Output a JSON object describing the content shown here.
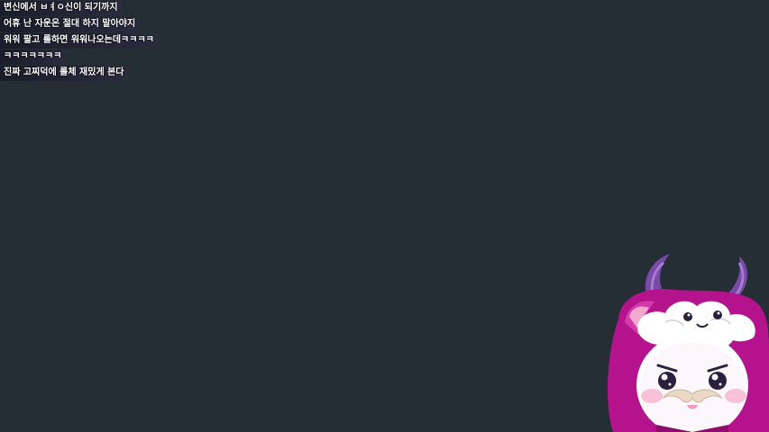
{
  "chat": {
    "messages": [
      {
        "text": "변신에서 ㅂㅕㅇ신이 되기까지"
      },
      {
        "text": "어휴 난 자운은 절대 하지 말아야지"
      },
      {
        "text": "워워 팔고 롤하면 워워나오는데ㅋㅋㅋㅋ"
      },
      {
        "text": "ㅋㅋㅋㅋㅋㅋㅋ"
      },
      {
        "text": "진짜 고찌덕에 롤체 재밌게 본다"
      }
    ]
  },
  "mascot": {
    "icon": "horned-magenta-hood-mascot-icon",
    "hood_color": "#b5128e",
    "horn_color": "#7a4aa8",
    "face_color": "#ffffff"
  }
}
